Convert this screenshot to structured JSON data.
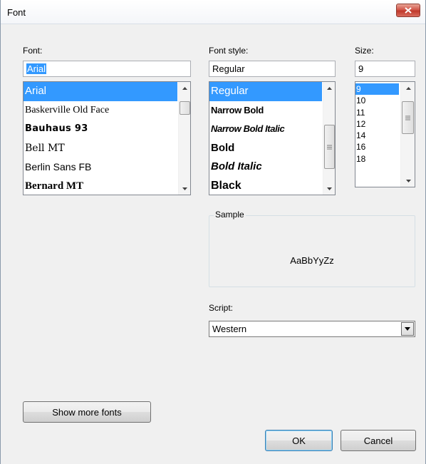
{
  "window": {
    "title": "Font"
  },
  "font": {
    "label": "Font:",
    "value": "Arial",
    "items": [
      {
        "label": "Arial",
        "selected": true
      },
      {
        "label": "Baskerville Old Face",
        "selected": false
      },
      {
        "label": "Bauhaus 93",
        "selected": false
      },
      {
        "label": "Bell MT",
        "selected": false
      },
      {
        "label": "Berlin Sans FB",
        "selected": false
      },
      {
        "label": "Bernard MT",
        "selected": false
      }
    ]
  },
  "style": {
    "label": "Font style:",
    "value": "Regular",
    "items": [
      {
        "label": "Regular",
        "selected": true
      },
      {
        "label": "Narrow Bold",
        "selected": false
      },
      {
        "label": "Narrow Bold Italic",
        "selected": false
      },
      {
        "label": "Bold",
        "selected": false
      },
      {
        "label": "Bold Italic",
        "selected": false
      },
      {
        "label": "Black",
        "selected": false
      }
    ]
  },
  "size": {
    "label": "Size:",
    "value": "9",
    "items": [
      {
        "label": "9",
        "selected": true
      },
      {
        "label": "10",
        "selected": false
      },
      {
        "label": "11",
        "selected": false
      },
      {
        "label": "12",
        "selected": false
      },
      {
        "label": "14",
        "selected": false
      },
      {
        "label": "16",
        "selected": false
      },
      {
        "label": "18",
        "selected": false
      }
    ]
  },
  "sample": {
    "label": "Sample",
    "text": "AaBbYyZz"
  },
  "script": {
    "label": "Script:",
    "value": "Western"
  },
  "buttons": {
    "more_fonts": "Show more fonts",
    "ok": "OK",
    "cancel": "Cancel"
  },
  "colors": {
    "selection": "#3399ff",
    "close_button": "#c0392b",
    "dialog_bg": "#f0f0f0"
  }
}
